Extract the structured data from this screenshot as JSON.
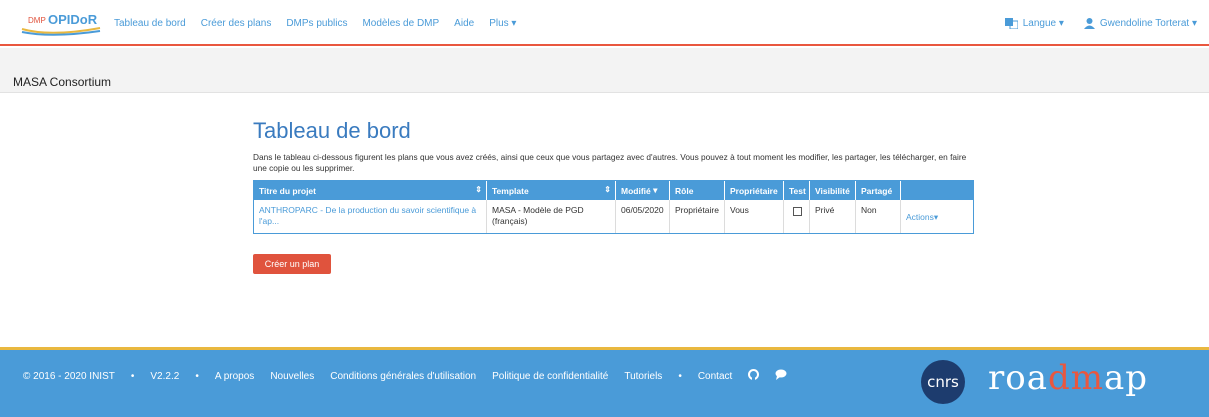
{
  "navbar": {
    "logo": "DMP OPIDoR",
    "links": [
      "Tableau de bord",
      "Créer des plans",
      "DMPs publics",
      "Modèles de DMP",
      "Aide",
      "Plus ▾"
    ],
    "language": "Langue ▾",
    "user": "Gwendoline Torterat ▾"
  },
  "org": {
    "name": "MASA Consortium"
  },
  "main": {
    "title": "Tableau de bord",
    "intro": "Dans le tableau ci-dessous figurent les plans que vous avez créés, ainsi que ceux que vous partagez avec d'autres. Vous pouvez à tout moment les modifier, les partager, les télécharger, en faire une copie ou les supprimer.",
    "create_button": "Créer un plan"
  },
  "table": {
    "headers": [
      "Titre du projet",
      "Template",
      "Modifié",
      "Rôle",
      "Propriétaire",
      "Test",
      "Visibilité",
      "Partagé",
      ""
    ],
    "rows": [
      {
        "title": "ANTHROPARC - De la production du savoir scientifique à l'ap...",
        "template": "MASA - Modèle de PGD (français)",
        "modified": "06/05/2020",
        "role": "Propriétaire",
        "owner": "Vous",
        "test": false,
        "visibility": "Privé",
        "shared": "Non",
        "actions": "Actions▾"
      }
    ]
  },
  "footer": {
    "copyright": "© 2016 - 2020 INIST",
    "version": "V2.2.2",
    "links": [
      "A propos",
      "Nouvelles",
      "Conditions générales d'utilisation",
      "Politique de confidentialité",
      "Tutoriels"
    ],
    "contact": "Contact",
    "cnrs": "cnrs",
    "roadmap_a": "roa",
    "roadmap_b": "dm",
    "roadmap_c": "ap"
  },
  "colors": {
    "accent": "#4a9bd8",
    "brand_red": "#e0533d",
    "footer_stripe": "#e9b83f"
  }
}
